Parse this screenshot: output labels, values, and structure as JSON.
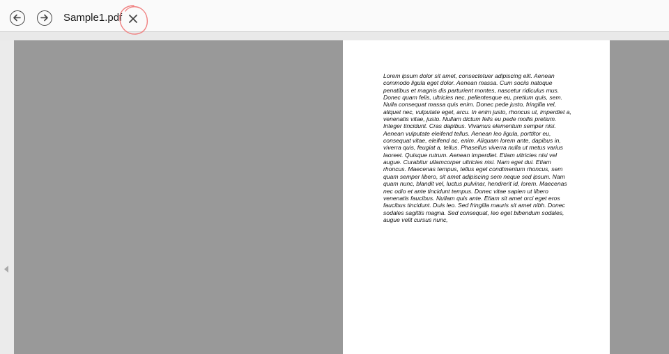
{
  "toolbar": {
    "file_title": "Sample1.pdf",
    "back_icon": "arrow-left-circle-icon",
    "forward_icon": "arrow-right-circle-icon",
    "close_icon": "close-x-icon"
  },
  "sidebar": {
    "collapse_icon": "triangle-left-icon"
  },
  "document": {
    "page_text": "Lorem ipsum dolor sit amet, consectetuer adipiscing elit. Aenean commodo ligula eget dolor. Aenean massa. Cum sociis natoque penatibus et magnis dis parturient montes, nascetur ridiculus mus. Donec quam felis, ultricies nec, pellentesque eu, pretium quis, sem. Nulla consequat massa quis enim. Donec pede justo, fringilla vel, aliquet nec, vulputate eget, arcu. In enim justo, rhoncus ut, imperdiet a, venenatis vitae, justo. Nullam dictum felis eu pede mollis pretium. Integer tincidunt. Cras dapibus. Vivamus elementum semper nisi. Aenean vulputate eleifend tellus. Aenean leo ligula, porttitor eu, consequat vitae, eleifend ac, enim. Aliquam lorem ante, dapibus in, viverra quis, feugiat a, tellus. Phasellus viverra nulla ut metus varius laoreet. Quisque rutrum. Aenean imperdiet. Etiam ultricies nisi vel augue. Curabitur ullamcorper ultricies nisi. Nam eget dui. Etiam rhoncus. Maecenas tempus, tellus eget condimentum rhoncus, sem quam semper libero, sit amet adipiscing sem neque sed ipsum. Nam quam nunc, blandit vel, luctus pulvinar, hendrerit id, lorem. Maecenas nec odio et ante tincidunt tempus. Donec vitae sapien ut libero venenatis faucibus. Nullam quis ante. Etiam sit amet orci eget eros faucibus tincidunt. Duis leo. Sed fringilla mauris sit amet nibh. Donec sodales sagittis magna. Sed consequat, leo eget bibendum sodales, augue velit cursus nunc,"
  },
  "colors": {
    "toolbar_bg": "#fafafa",
    "viewer_bg": "#999999",
    "page_bg": "#ffffff",
    "annotation": "#f08080"
  }
}
